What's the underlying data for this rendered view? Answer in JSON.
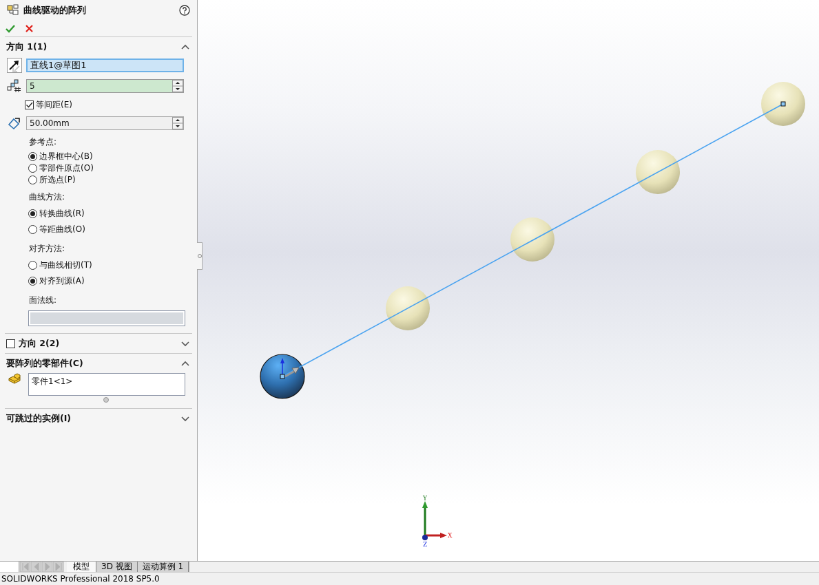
{
  "feature": {
    "title": "曲线驱动的阵列"
  },
  "direction1": {
    "label": "方向 1(1)",
    "expanded": true,
    "path": "直线1@草图1",
    "count": "5",
    "equal_spacing": {
      "label": "等间距(E)",
      "checked": true
    },
    "spacing": "50.00mm",
    "groups": [
      {
        "label": "参考点:",
        "options": [
          {
            "label": "边界框中心(B)",
            "selected": true
          },
          {
            "label": "零部件原点(O)",
            "selected": false
          },
          {
            "label": "所选点(P)",
            "selected": false
          }
        ]
      },
      {
        "label": "曲线方法:",
        "options": [
          {
            "label": "转换曲线(R)",
            "selected": true
          },
          {
            "label": "等距曲线(O)",
            "selected": false
          }
        ]
      },
      {
        "label": "对齐方法:",
        "options": [
          {
            "label": "与曲线相切(T)",
            "selected": false
          },
          {
            "label": "对齐到源(A)",
            "selected": true
          }
        ]
      }
    ],
    "face_normal": {
      "label": "面法线:"
    }
  },
  "direction2": {
    "label": "方向 2(2)",
    "checked": false,
    "expanded": false
  },
  "components": {
    "label": "要阵列的零部件(C)",
    "expanded": true,
    "items": [
      "零件1<1>"
    ]
  },
  "skip_instances": {
    "label": "可跳过的实例(I)",
    "expanded": false
  },
  "axes": {
    "x": "X",
    "y": "Y",
    "z": "Z"
  },
  "tabs": [
    {
      "label": "模型",
      "selected": true
    },
    {
      "label": "3D 视图",
      "selected": false
    },
    {
      "label": "运动算例 1",
      "selected": false
    }
  ],
  "status_bar": "SOLIDWORKS Professional 2018 SP5.0"
}
